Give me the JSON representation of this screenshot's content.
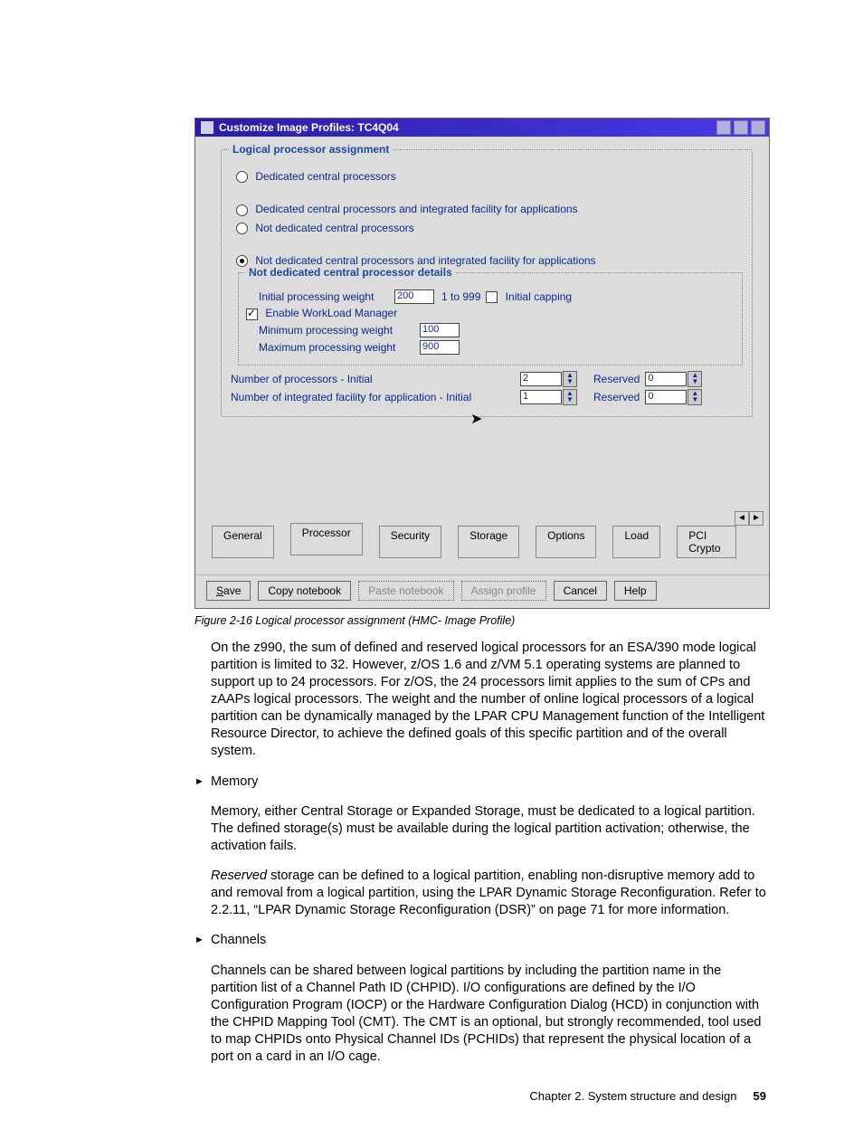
{
  "dialog": {
    "title": "Customize Image Profiles: TC4Q04",
    "group_label": "Logical processor assignment",
    "radios": {
      "r1": "Dedicated central processors",
      "r2": "Dedicated central processors and integrated facility for applications",
      "r3": "Not dedicated central processors",
      "r4": "Not dedicated central processors and integrated facility for applications"
    },
    "subgroup_label": "Not dedicated central processor details",
    "initial_weight_label": "Initial processing weight",
    "initial_weight_value": "200",
    "initial_weight_hint": "1 to 999",
    "initial_capping_label": "Initial capping",
    "enable_wlm_label": "Enable WorkLoad Manager",
    "min_weight_label": "Minimum processing weight",
    "min_weight_value": "100",
    "max_weight_label": "Maximum processing weight",
    "max_weight_value": "900",
    "num_proc_label": "Number of processors - Initial",
    "num_proc_value": "2",
    "num_ifa_label": "Number of integrated facility for application - Initial",
    "num_ifa_value": "1",
    "reserved_label": "Reserved",
    "reserved_proc_value": "0",
    "reserved_ifa_value": "0",
    "tabs": [
      "General",
      "Processor",
      "Security",
      "Storage",
      "Options",
      "Load",
      "PCI Crypto"
    ],
    "buttons": {
      "save": "Save",
      "copy": "Copy notebook",
      "paste": "Paste notebook",
      "assign": "Assign profile",
      "cancel": "Cancel",
      "help": "Help"
    }
  },
  "caption": "Figure 2-16   Logical processor assignment (HMC- Image Profile)",
  "paras": {
    "p1": "On the z990, the sum of defined and reserved logical processors for an ESA/390 mode logical partition is limited to 32. However, z/OS 1.6 and z/VM 5.1 operating systems are planned to support up to 24 processors. For z/OS, the 24 processors limit applies to the sum of CPs and zAAPs logical processors. The weight and the number of online logical processors of a logical partition can be dynamically managed by the LPAR CPU Management function of the Intelligent Resource Director, to achieve the defined goals of this specific partition and of the overall system.",
    "bullet_memory": "Memory",
    "p2": "Memory, either Central Storage or Expanded Storage, must be dedicated to a logical partition. The defined storage(s) must be available during the logical partition activation; otherwise, the activation fails.",
    "p3a": "Reserved",
    "p3b": " storage can be defined to a logical partition, enabling non-disruptive memory add to and removal from a logical partition, using the LPAR Dynamic Storage Reconfiguration. Refer to 2.2.11, “LPAR Dynamic Storage Reconfiguration (DSR)” on page 71 for more information.",
    "bullet_channels": "Channels",
    "p4": "Channels can be shared between logical partitions by including the partition name in the partition list of a Channel Path ID (CHPID). I/O configurations are defined by the I/O Configuration Program (IOCP) or the Hardware Configuration Dialog (HCD) in conjunction with the CHPID Mapping Tool (CMT). The CMT is an optional, but strongly recommended, tool used to map CHPIDs onto Physical Channel IDs (PCHIDs) that represent the physical location of a port on a card in an I/O cage."
  },
  "footer": {
    "chapter": "Chapter 2. System structure and design",
    "page": "59"
  }
}
